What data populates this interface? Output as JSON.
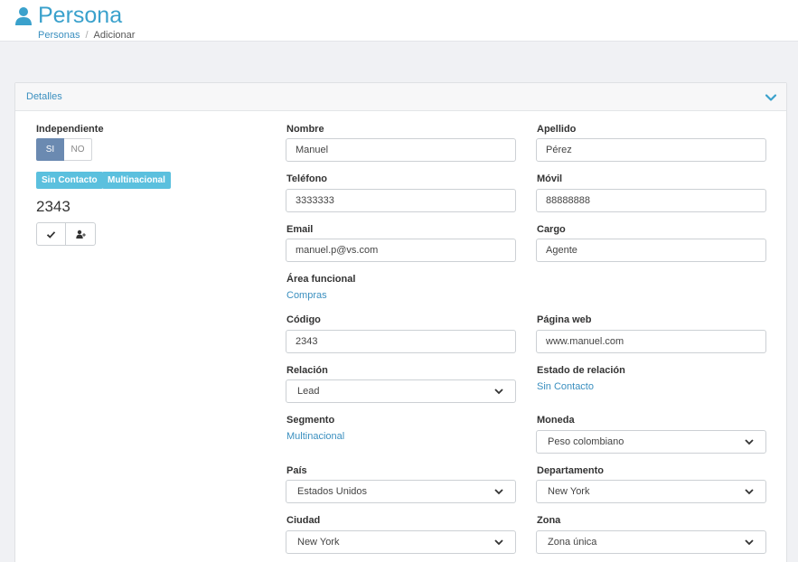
{
  "header": {
    "title": "Persona",
    "breadcrumb": {
      "link": "Personas",
      "separator": "/",
      "current": "Adicionar"
    }
  },
  "card": {
    "title": "Detalles"
  },
  "left": {
    "independiente_label": "Independiente",
    "toggle_si": "SI",
    "toggle_no": "NO",
    "badges": [
      "Sin Contacto",
      "Multinacional"
    ],
    "number": "2343"
  },
  "form": {
    "nombre": {
      "label": "Nombre",
      "value": "Manuel"
    },
    "apellido": {
      "label": "Apellido",
      "value": "Pérez"
    },
    "telefono": {
      "label": "Teléfono",
      "value": "3333333"
    },
    "movil": {
      "label": "Móvil",
      "value": "88888888"
    },
    "email": {
      "label": "Email",
      "value": "manuel.p@vs.com"
    },
    "cargo": {
      "label": "Cargo",
      "value": "Agente"
    },
    "area": {
      "label": "Área funcional",
      "value": "Compras"
    },
    "codigo": {
      "label": "Código",
      "value": "2343"
    },
    "web": {
      "label": "Página web",
      "value": "www.manuel.com"
    },
    "relacion": {
      "label": "Relación",
      "value": "Lead"
    },
    "estado": {
      "label": "Estado de relación",
      "value": "Sin Contacto"
    },
    "segmento": {
      "label": "Segmento",
      "value": "Multinacional"
    },
    "moneda": {
      "label": "Moneda",
      "value": "Peso colombiano"
    },
    "pais": {
      "label": "País",
      "value": "Estados Unidos"
    },
    "departamento": {
      "label": "Departamento",
      "value": "New York"
    },
    "ciudad": {
      "label": "Ciudad",
      "value": "New York"
    },
    "zona": {
      "label": "Zona",
      "value": "Zona única"
    }
  },
  "colors": {
    "accent": "#3aa1cc",
    "link": "#3a8fbf",
    "badge": "#5bc0de",
    "toggle_on": "#6b8ab1"
  },
  "icons": [
    "user-icon",
    "chevron-down-icon",
    "check-icon",
    "add-user-icon"
  ]
}
